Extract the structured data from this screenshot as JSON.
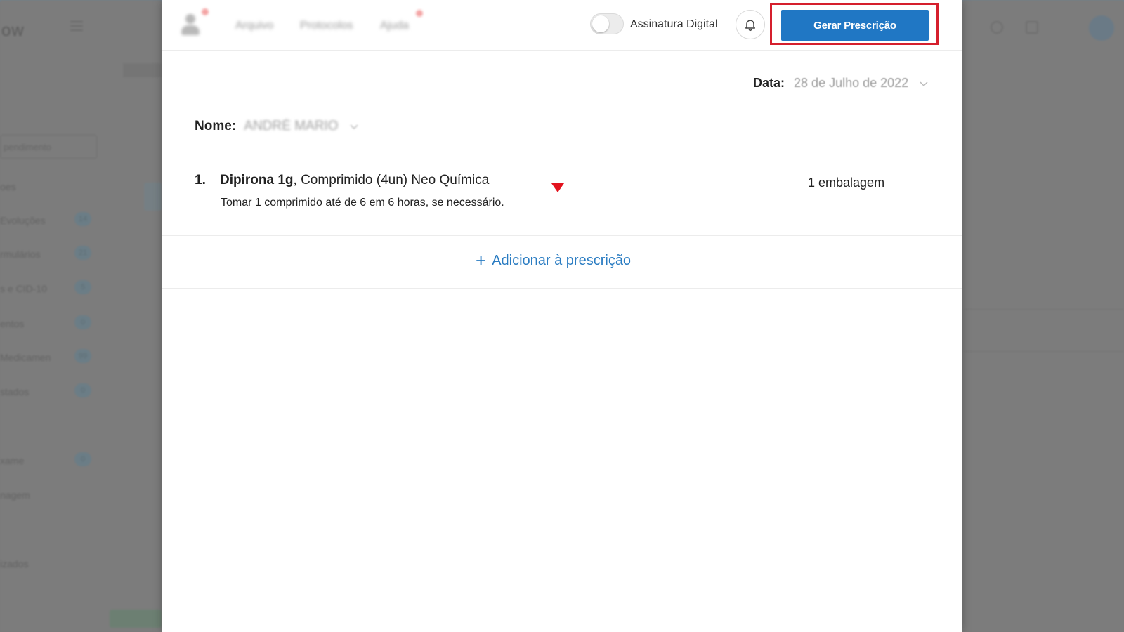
{
  "background": {
    "logo_text": "ow",
    "search_text": "pendimento",
    "sidebar": [
      {
        "label": "oes",
        "badge": ""
      },
      {
        "label": "Evoluções",
        "badge": "14"
      },
      {
        "label": "rmulários",
        "badge": "21"
      },
      {
        "label": "s e CID-10",
        "badge": "5"
      },
      {
        "label": "entos",
        "badge": "0"
      },
      {
        "label": "Medicamen",
        "badge": "99"
      },
      {
        "label": "stados",
        "badge": "0"
      },
      {
        "label": "xame",
        "badge": "0"
      },
      {
        "label": "nagem",
        "badge": ""
      },
      {
        "label": "izados",
        "badge": ""
      }
    ]
  },
  "header": {
    "nav_links": [
      "Arquivo",
      "Protocolos",
      "Ajuda"
    ],
    "toggle_label": "Assinatura Digital",
    "toggle_on": false,
    "generate_button_label": "Gerar Prescrição",
    "accent_color": "#2077c4",
    "highlight_color": "#d51f2d"
  },
  "form": {
    "date_label": "Data:",
    "date_value": "28 de Julho de 2022",
    "name_label": "Nome:",
    "name_value": "ANDRÉ MARIO"
  },
  "prescription": {
    "items": [
      {
        "number": "1.",
        "drug_name": "Dipirona 1g",
        "drug_detail": ", Comprimido (4un) Neo Química",
        "instructions": "Tomar 1 comprimido até de 6 em 6 horas, se necessário.",
        "quantity": "1 embalagem"
      }
    ],
    "add_label": "Adicionar à prescrição",
    "add_icon": "+"
  }
}
